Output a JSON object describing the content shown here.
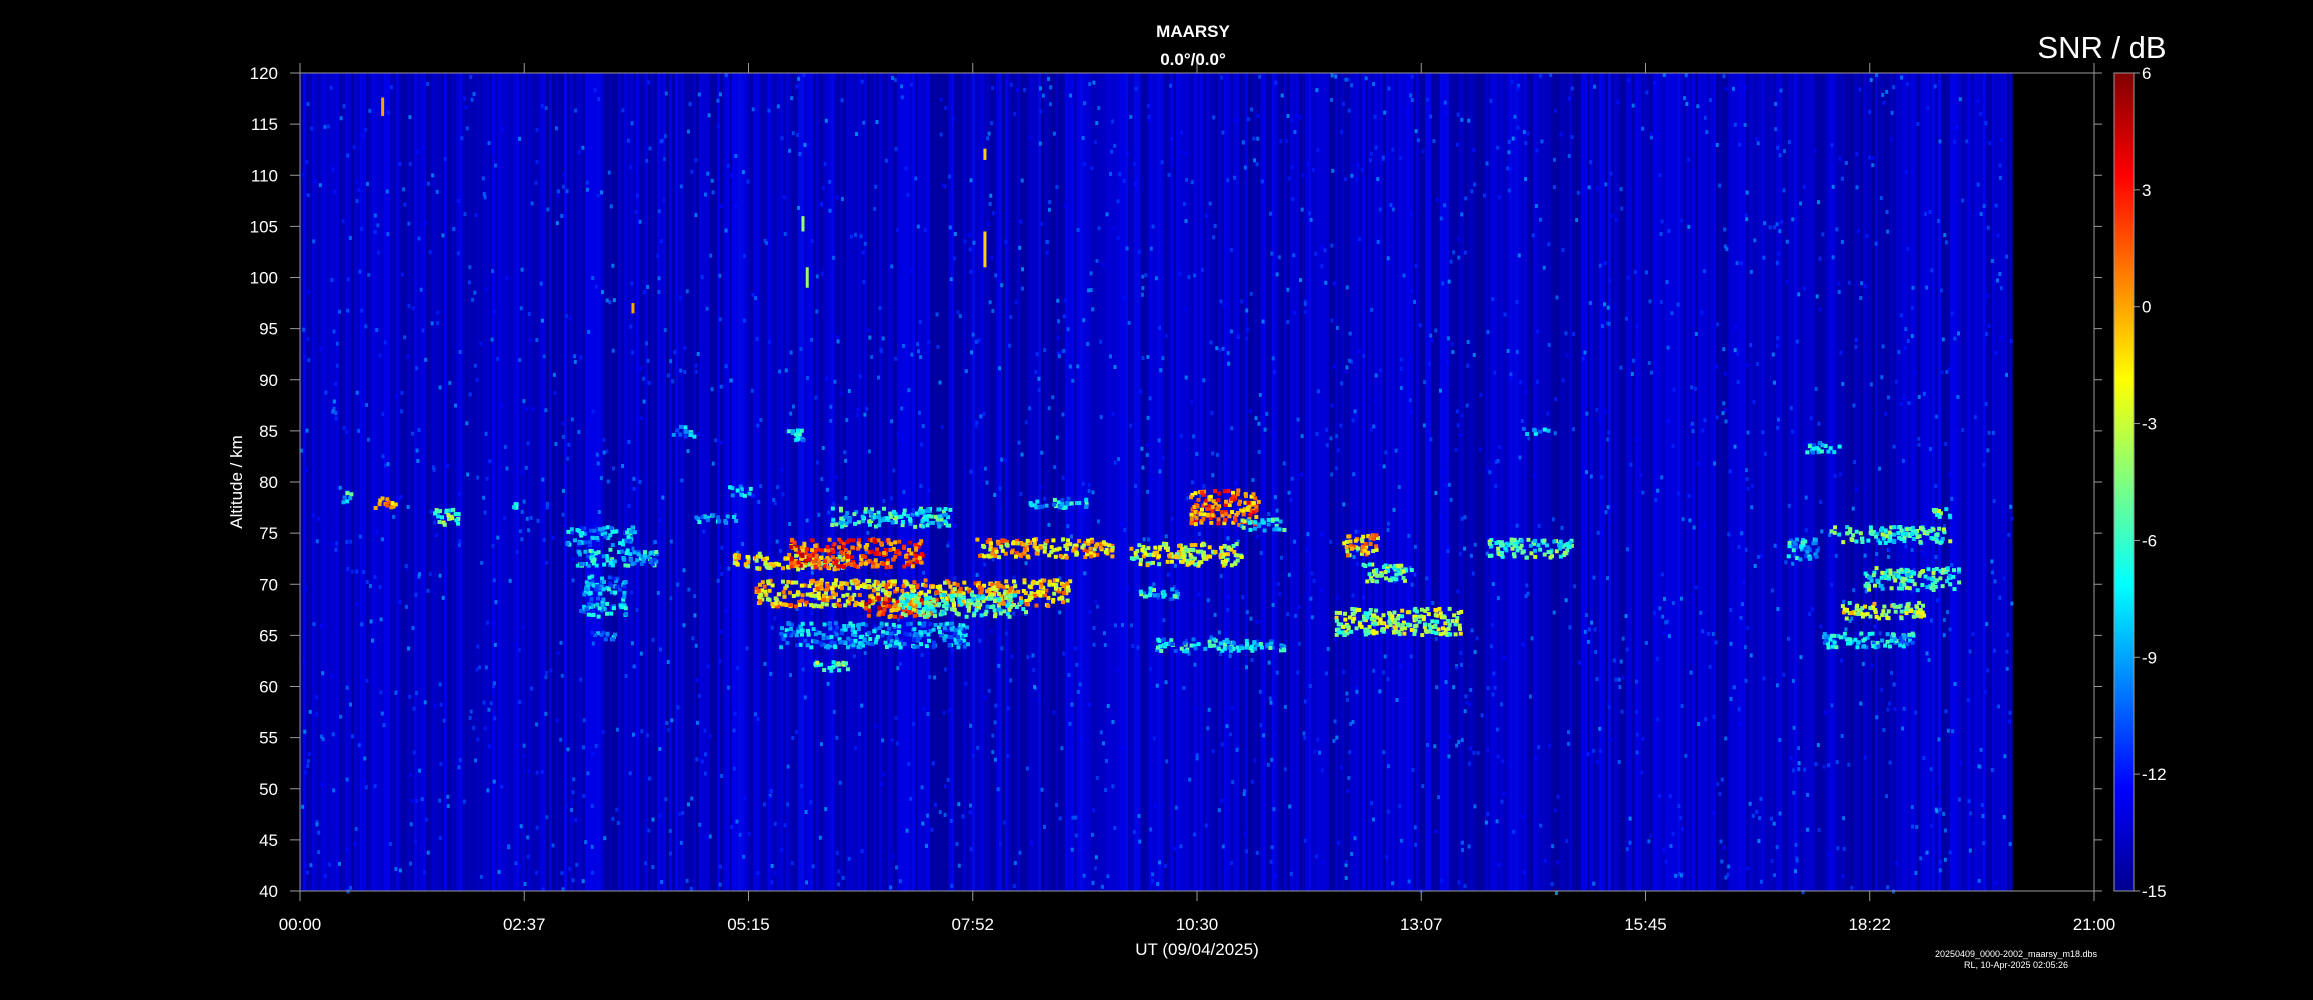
{
  "chart_data": {
    "type": "heatmap",
    "title": "MAARSY",
    "subtitle": "0.0°/0.0°",
    "xlabel": "UT (09/04/2025)",
    "ylabel": "Altitude / km",
    "colorbar_label": "SNR / dB",
    "x_ticks": [
      "00:00",
      "02:37",
      "05:15",
      "07:52",
      "10:30",
      "13:07",
      "15:45",
      "18:22",
      "21:00"
    ],
    "x_range_hours": [
      0,
      21
    ],
    "data_end_hours": 20.03,
    "y_ticks": [
      40,
      45,
      50,
      55,
      60,
      65,
      70,
      75,
      80,
      85,
      90,
      95,
      100,
      105,
      110,
      115,
      120
    ],
    "ylim": [
      40,
      120
    ],
    "colorbar_ticks": [
      6,
      3,
      0,
      -3,
      -6,
      -9,
      -12,
      -15
    ],
    "colorbar_range": [
      -15,
      6
    ],
    "background_snr_db": -13.5,
    "echo_regions": [
      {
        "t": [
          0.45,
          0.6
        ],
        "alt": [
          78.2,
          79.2
        ],
        "snr": -7
      },
      {
        "t": [
          0.85,
          1.1
        ],
        "alt": [
          77.6,
          78.6
        ],
        "snr": -1
      },
      {
        "t": [
          1.55,
          1.85
        ],
        "alt": [
          76.0,
          77.6
        ],
        "snr": -5
      },
      {
        "t": [
          2.45,
          2.6
        ],
        "alt": [
          77.6,
          78.2
        ],
        "snr": -9
      },
      {
        "t": [
          3.1,
          3.9
        ],
        "alt": [
          74.0,
          75.8
        ],
        "snr": -9
      },
      {
        "t": [
          3.2,
          4.2
        ],
        "alt": [
          72.0,
          73.6
        ],
        "snr": -8
      },
      {
        "t": [
          3.3,
          3.8
        ],
        "alt": [
          67.0,
          71.0
        ],
        "snr": -9
      },
      {
        "t": [
          3.4,
          3.7
        ],
        "alt": [
          64.8,
          65.6
        ],
        "snr": -9
      },
      {
        "t": [
          4.35,
          4.6
        ],
        "alt": [
          84.6,
          85.6
        ],
        "snr": -9
      },
      {
        "t": [
          4.6,
          5.1
        ],
        "alt": [
          76.2,
          77.0
        ],
        "snr": -8
      },
      {
        "t": [
          5.0,
          5.3
        ],
        "alt": [
          78.8,
          79.8
        ],
        "snr": -9
      },
      {
        "t": [
          5.05,
          6.4
        ],
        "alt": [
          71.6,
          73.2
        ],
        "snr": -2
      },
      {
        "t": [
          5.7,
          7.3
        ],
        "alt": [
          71.8,
          74.6
        ],
        "snr": 2
      },
      {
        "t": [
          5.7,
          5.95
        ],
        "alt": [
          84.2,
          85.4
        ],
        "snr": -8
      },
      {
        "t": [
          5.3,
          9.0
        ],
        "alt": [
          68.0,
          70.6
        ],
        "snr": -1
      },
      {
        "t": [
          6.6,
          7.4
        ],
        "alt": [
          67.0,
          69.0
        ],
        "snr": 2
      },
      {
        "t": [
          7.0,
          8.5
        ],
        "alt": [
          67.0,
          69.2
        ],
        "snr": -6
      },
      {
        "t": [
          5.6,
          7.8
        ],
        "alt": [
          64.0,
          66.4
        ],
        "snr": -9
      },
      {
        "t": [
          6.0,
          6.4
        ],
        "alt": [
          61.6,
          62.6
        ],
        "snr": -5
      },
      {
        "t": [
          6.2,
          7.6
        ],
        "alt": [
          75.8,
          77.6
        ],
        "snr": -7
      },
      {
        "t": [
          7.9,
          9.5
        ],
        "alt": [
          72.8,
          74.6
        ],
        "snr": -1
      },
      {
        "t": [
          8.5,
          9.2
        ],
        "alt": [
          77.6,
          78.6
        ],
        "snr": -8
      },
      {
        "t": [
          9.7,
          11.0
        ],
        "alt": [
          72.0,
          74.2
        ],
        "snr": -3
      },
      {
        "t": [
          10.4,
          11.2
        ],
        "alt": [
          76.0,
          79.4
        ],
        "snr": 1
      },
      {
        "t": [
          11.0,
          11.5
        ],
        "alt": [
          75.4,
          76.6
        ],
        "snr": -7
      },
      {
        "t": [
          9.8,
          10.3
        ],
        "alt": [
          68.8,
          69.8
        ],
        "snr": -7
      },
      {
        "t": [
          10.0,
          11.5
        ],
        "alt": [
          63.6,
          64.8
        ],
        "snr": -8
      },
      {
        "t": [
          12.2,
          12.6
        ],
        "alt": [
          73.0,
          75.0
        ],
        "snr": -1
      },
      {
        "t": [
          12.4,
          13.0
        ],
        "alt": [
          70.4,
          72.2
        ],
        "snr": -5
      },
      {
        "t": [
          12.1,
          13.6
        ],
        "alt": [
          65.2,
          67.8
        ],
        "snr": -4
      },
      {
        "t": [
          13.9,
          14.9
        ],
        "alt": [
          72.8,
          74.6
        ],
        "snr": -6
      },
      {
        "t": [
          14.3,
          14.6
        ],
        "alt": [
          84.8,
          85.4
        ],
        "snr": -9
      },
      {
        "t": [
          17.4,
          17.75
        ],
        "alt": [
          72.6,
          74.6
        ],
        "snr": -8
      },
      {
        "t": [
          17.6,
          18.0
        ],
        "alt": [
          83.0,
          84.0
        ],
        "snr": -8
      },
      {
        "t": [
          17.9,
          19.3
        ],
        "alt": [
          74.2,
          75.8
        ],
        "snr": -6
      },
      {
        "t": [
          18.0,
          19.0
        ],
        "alt": [
          66.8,
          68.4
        ],
        "snr": -3
      },
      {
        "t": [
          18.3,
          19.4
        ],
        "alt": [
          69.6,
          71.8
        ],
        "snr": -6
      },
      {
        "t": [
          17.8,
          18.9
        ],
        "alt": [
          64.0,
          65.4
        ],
        "snr": -8
      },
      {
        "t": [
          19.1,
          19.3
        ],
        "alt": [
          76.6,
          77.6
        ],
        "snr": -5
      }
    ],
    "vertical_streaks": [
      {
        "t": 0.95,
        "alt": [
          115.8,
          117.6
        ],
        "snr": 0
      },
      {
        "t": 5.92,
        "alt": [
          99.0,
          101.0
        ],
        "snr": -4
      },
      {
        "t": 5.87,
        "alt": [
          104.5,
          106.0
        ],
        "snr": -4
      },
      {
        "t": 8.0,
        "alt": [
          101.0,
          104.5
        ],
        "snr": -1
      },
      {
        "t": 8.0,
        "alt": [
          111.5,
          112.6
        ],
        "snr": -1
      },
      {
        "t": 3.88,
        "alt": [
          96.5,
          97.5
        ],
        "snr": 0
      }
    ],
    "grid": false,
    "colorscale": "jet"
  },
  "footer_note_line1": "20250409_0000-2002_maarsy_m18.dbs",
  "footer_note_line2": "RL, 10-Apr-2025 02:05:26"
}
